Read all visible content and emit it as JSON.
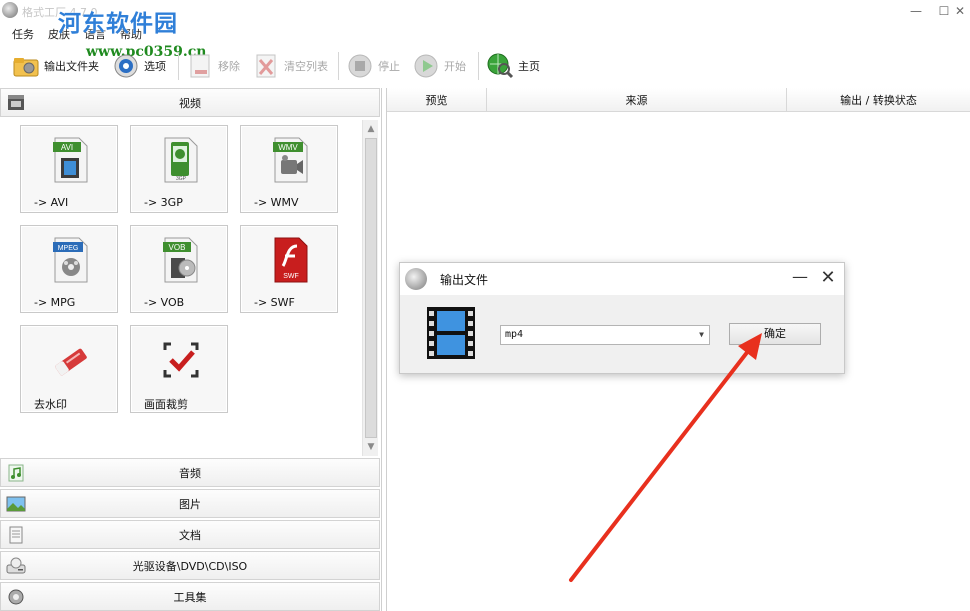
{
  "window": {
    "title": "格式工厂 4.7.0",
    "minimize_glyph": "—",
    "maximize_glyph": "☐",
    "close_glyph": "✕"
  },
  "watermark": {
    "text": "河东软件园",
    "url": "www.pc0359.cn"
  },
  "menu": {
    "items": [
      "任务",
      "皮肤",
      "语言",
      "帮助"
    ]
  },
  "toolbar": {
    "output_folder": "输出文件夹",
    "options": "选项",
    "remove": "移除",
    "clear_list": "清空列表",
    "stop": "停止",
    "start": "开始",
    "home": "主页"
  },
  "left": {
    "video_header": "视频",
    "tiles": [
      {
        "label": "-> AVI",
        "badge": "AVI",
        "badge_color": "#3f8f2f"
      },
      {
        "label": "-> 3GP",
        "badge": "3GP",
        "badge_color": "#3f8f2f"
      },
      {
        "label": "-> WMV",
        "badge": "WMV",
        "badge_color": "#3f8f2f"
      },
      {
        "label": "-> MPG",
        "badge": "MPEG",
        "badge_color": "#2b6cb8"
      },
      {
        "label": "-> VOB",
        "badge": "VOB",
        "badge_color": "#3f8f2f"
      },
      {
        "label": "-> SWF",
        "badge": "SWF",
        "badge_color": "#c81e1e"
      },
      {
        "label": "去水印",
        "badge": "",
        "badge_color": "#d63a3a"
      },
      {
        "label": "画面裁剪",
        "badge": "",
        "badge_color": "#c81e1e"
      }
    ],
    "categories": [
      "音频",
      "图片",
      "文档",
      "光驱设备\\DVD\\CD\\ISO",
      "工具集"
    ]
  },
  "table": {
    "columns": [
      "预览",
      "来源",
      "输出 / 转换状态"
    ]
  },
  "dialog": {
    "title": "输出文件",
    "format_value": "mp4",
    "ok_label": "确定",
    "minimize_glyph": "—",
    "close_glyph": "✕"
  },
  "colors": {
    "annotation_arrow": "#e8301e",
    "watermark_blue": "#2f7fd8",
    "watermark_green": "#1f8a1f"
  }
}
